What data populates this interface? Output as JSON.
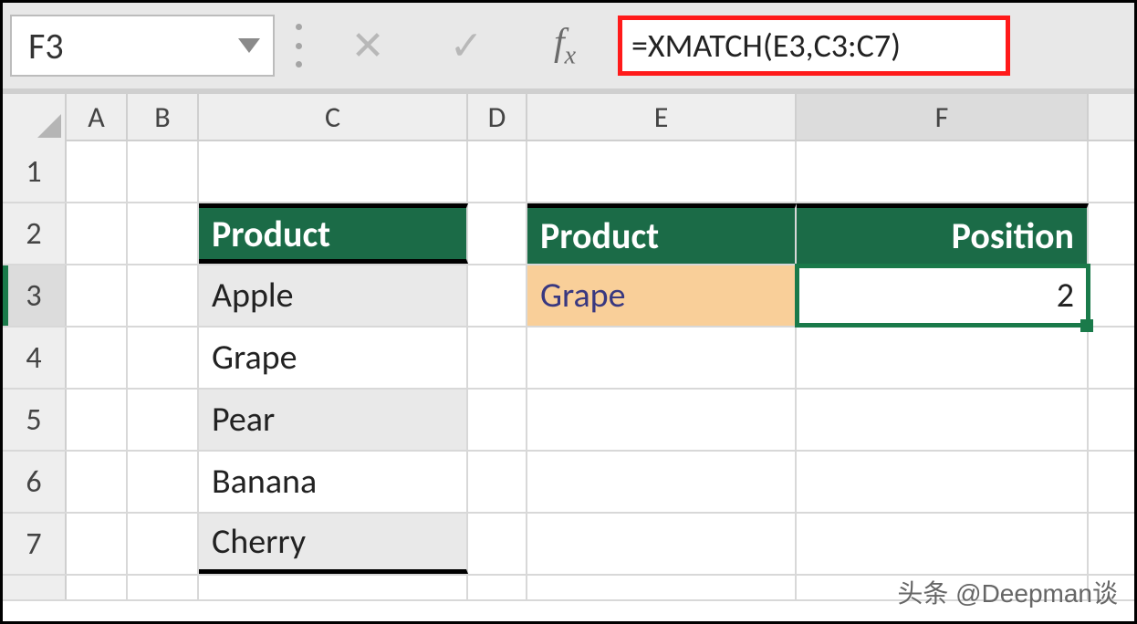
{
  "name_box": {
    "value": "F3"
  },
  "formula_bar": {
    "formula": "=XMATCH(E3,C3:C7)"
  },
  "columns": {
    "A": "A",
    "B": "B",
    "C": "C",
    "D": "D",
    "E": "E",
    "F": "F"
  },
  "row_numbers": {
    "r1": "1",
    "r2": "2",
    "r3": "3",
    "r4": "4",
    "r5": "5",
    "r6": "6",
    "r7": "7"
  },
  "table1": {
    "header": "Product",
    "items": [
      "Apple",
      "Grape",
      "Pear",
      "Banana",
      "Cherry"
    ]
  },
  "table2": {
    "header_product": "Product",
    "header_position": "Position",
    "lookup_value": "Grape",
    "result": "2"
  },
  "watermark": "头条 @Deepman谈"
}
